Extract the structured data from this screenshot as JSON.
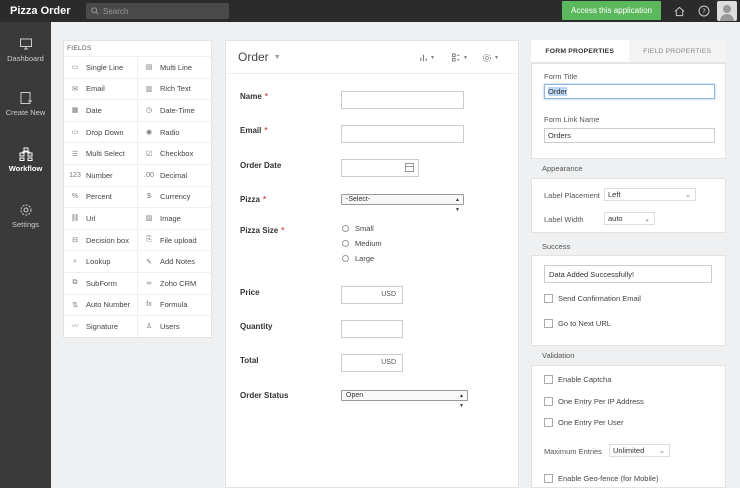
{
  "app": {
    "title": "Pizza Order",
    "search_placeholder": "Search",
    "access_button": "Access this application"
  },
  "nav": [
    {
      "label": "Dashboard",
      "icon": "monitor-icon"
    },
    {
      "label": "Create New",
      "icon": "create-new-icon"
    },
    {
      "label": "Workflow",
      "icon": "workflow-icon"
    },
    {
      "label": "Settings",
      "icon": "gear-icon"
    }
  ],
  "fields": {
    "header": "FIELDS",
    "items": [
      {
        "label": "Single Line",
        "glyph": "▭"
      },
      {
        "label": "Multi Line",
        "glyph": "▤"
      },
      {
        "label": "Email",
        "glyph": "✉"
      },
      {
        "label": "Rich Text",
        "glyph": "▥"
      },
      {
        "label": "Date",
        "glyph": "▦"
      },
      {
        "label": "Date-Time",
        "glyph": "◷"
      },
      {
        "label": "Drop Down",
        "glyph": "▭"
      },
      {
        "label": "Radio",
        "glyph": "◉"
      },
      {
        "label": "Multi Select",
        "glyph": "☰"
      },
      {
        "label": "Checkbox",
        "glyph": "☑"
      },
      {
        "label": "Number",
        "glyph": "123"
      },
      {
        "label": "Decimal",
        "glyph": ".00"
      },
      {
        "label": "Percent",
        "glyph": "%"
      },
      {
        "label": "Currency",
        "glyph": "$"
      },
      {
        "label": "Url",
        "glyph": "⛓"
      },
      {
        "label": "Image",
        "glyph": "▨"
      },
      {
        "label": "Decision box",
        "glyph": "⊟"
      },
      {
        "label": "File upload",
        "glyph": "⎘"
      },
      {
        "label": "Lookup",
        "glyph": "⌕"
      },
      {
        "label": "Add Notes",
        "glyph": "✎"
      },
      {
        "label": "SubForm",
        "glyph": "⧉"
      },
      {
        "label": "Zoho CRM",
        "glyph": "∞"
      },
      {
        "label": "Auto Number",
        "glyph": "⇅"
      },
      {
        "label": "Formula",
        "glyph": "fx"
      },
      {
        "label": "Signature",
        "glyph": "〰"
      },
      {
        "label": "Users",
        "glyph": "♙"
      }
    ]
  },
  "form": {
    "name": "Order",
    "fields": {
      "name_label": "Name",
      "email_label": "Email",
      "order_date_label": "Order Date",
      "pizza_label": "Pizza",
      "pizza_value": "-Select-",
      "pizza_size_label": "Pizza Size",
      "size_options": [
        "Small",
        "Medium",
        "Large"
      ],
      "price_label": "Price",
      "price_suffix": "USD",
      "quantity_label": "Quantity",
      "total_label": "Total",
      "total_suffix": "USD",
      "order_status_label": "Order Status",
      "order_status_value": "Open"
    }
  },
  "properties": {
    "tab_form": "FORM PROPERTIES",
    "tab_field": "FIELD PROPERTIES",
    "form_title_label": "Form Title",
    "form_title_value": "Order",
    "form_link_label": "Form Link Name",
    "form_link_value": "Orders",
    "appearance_header": "Appearance",
    "label_placement_label": "Label Placement",
    "label_placement_value": "Left",
    "label_width_label": "Label Width",
    "label_width_value": "auto",
    "success_header": "Success",
    "success_message": "Data Added Successfully!",
    "send_email_label": "Send Confirmation Email",
    "next_url_label": "Go to Next URL",
    "validation_header": "Validation",
    "captcha_label": "Enable Captcha",
    "one_per_ip_label": "One Entry Per IP Address",
    "one_per_user_label": "One Entry Per User",
    "max_entries_label": "Maximum Entries",
    "max_entries_value": "Unlimited",
    "geofence_label": "Enable Geo-fence (for Mobile)"
  },
  "colors": {
    "topbar": "#2b2b2b",
    "leftnav": "#3a3a3a",
    "accent_green": "#5cb85c",
    "required_red": "#d9534f"
  }
}
